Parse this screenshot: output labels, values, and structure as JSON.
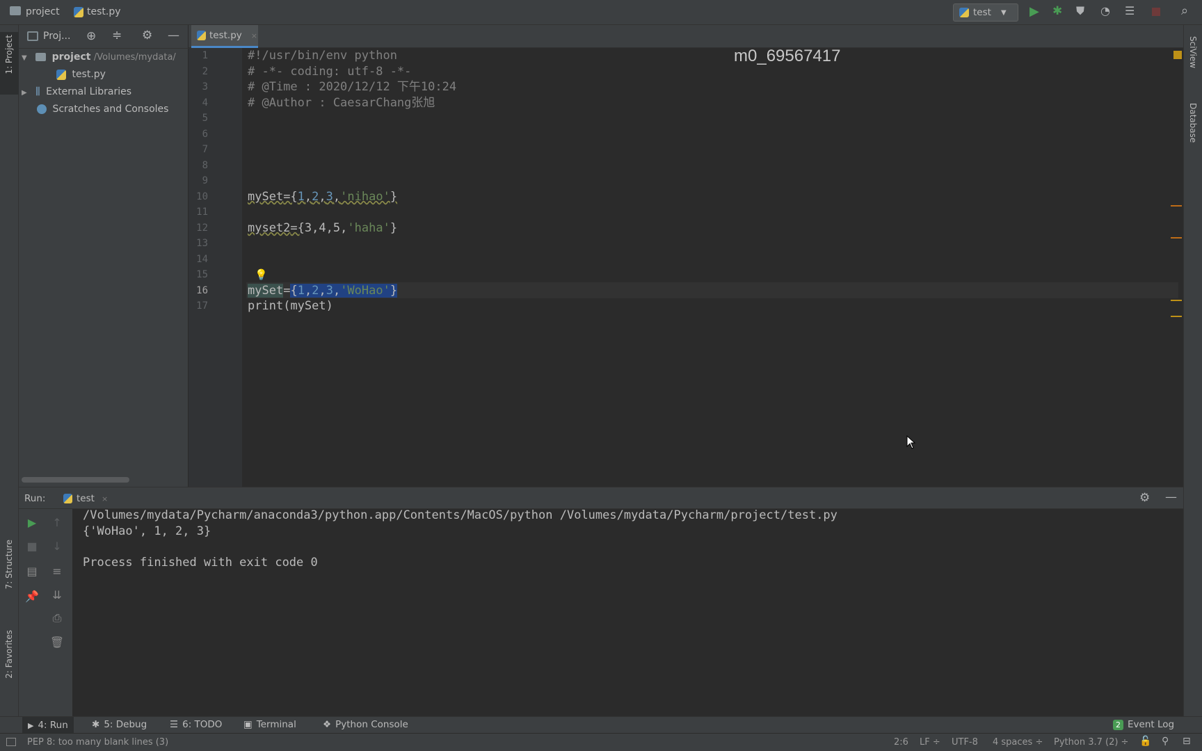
{
  "titlebar": {
    "project": "project",
    "file": "test.py",
    "run_config": "test"
  },
  "left_strip": {
    "project_tab": "1: Project",
    "structure_tab": "7: Structure",
    "favorites_tab": "2: Favorites"
  },
  "right_strip": {
    "sciview_tab": "SciView",
    "database_tab": "Database"
  },
  "project_panel": {
    "header": "Proj...",
    "root_name": "project",
    "root_path": "/Volumes/mydata/",
    "file": "test.py",
    "external": "External Libraries",
    "scratches": "Scratches and Consoles"
  },
  "editor": {
    "tab": "test.py",
    "watermark": "m0_69567417",
    "lines": [
      {
        "n": "1"
      },
      {
        "n": "2"
      },
      {
        "n": "3"
      },
      {
        "n": "4"
      },
      {
        "n": "5"
      },
      {
        "n": "6"
      },
      {
        "n": "7"
      },
      {
        "n": "8"
      },
      {
        "n": "9"
      },
      {
        "n": "10"
      },
      {
        "n": "11"
      },
      {
        "n": "12"
      },
      {
        "n": "13"
      },
      {
        "n": "14"
      },
      {
        "n": "15"
      },
      {
        "n": "16"
      },
      {
        "n": "17"
      }
    ],
    "code": {
      "l1": "#!/usr/bin/env python",
      "l2": "# -*- coding: utf-8 -*-",
      "l3": "# @Time : 2020/12/12 下午10:24",
      "l4": "# @Author : CaesarChang张旭",
      "l10_var": "mySet",
      "l10_nums": [
        "1",
        "2",
        "3"
      ],
      "l10_str": "'nihao'",
      "l12_var": "myset2",
      "l12_nums": [
        "3",
        "4",
        "5"
      ],
      "l12_str": "'haha'",
      "l16_var": "mySet",
      "l16_nums": [
        "1",
        "2",
        "3"
      ],
      "l16_str": "'WoHao'",
      "l17_fn": "print",
      "l17_arg": "mySet"
    }
  },
  "run": {
    "label": "Run:",
    "tab": "test",
    "output_line1": "/Volumes/mydata/Pycharm/anaconda3/python.app/Contents/MacOS/python /Volumes/mydata/Pycharm/project/test.py",
    "output_line2": "{'WoHao', 1, 2, 3}",
    "output_line3": "Process finished with exit code 0"
  },
  "bottom_tabs": {
    "run": "4: Run",
    "debug": "5: Debug",
    "todo": "6: TODO",
    "terminal": "Terminal",
    "python_console": "Python Console",
    "event_log": "Event Log",
    "event_count": "2"
  },
  "status": {
    "message": "PEP 8: too many blank lines (3)",
    "position": "2:6",
    "line_sep": "LF ÷",
    "encoding": "UTF-8",
    "indent": "4 spaces ÷",
    "interpreter": "Python 3.7 (2) ÷"
  },
  "colors": {
    "accent_run": "#499c54",
    "selection": "#214283",
    "warning_marker": "#be9117"
  }
}
